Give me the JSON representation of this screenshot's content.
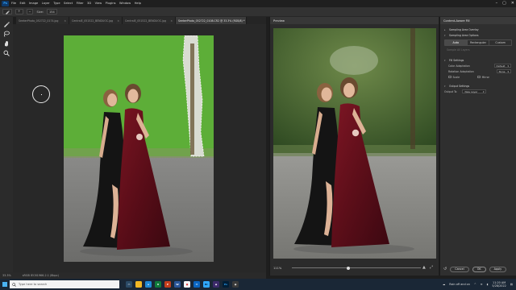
{
  "app": {
    "logo_text": "Ps",
    "menu": [
      "File",
      "Edit",
      "Image",
      "Layer",
      "Type",
      "Select",
      "Filter",
      "3D",
      "View",
      "Plugins",
      "Window",
      "Help"
    ],
    "window_controls": [
      "–",
      "▢",
      "✕"
    ]
  },
  "options_bar": {
    "size_label": "Size:",
    "size_value": "154"
  },
  "tabs": [
    {
      "label": "SeekerPhoto_052722_0174.jpg",
      "close": "×",
      "active": false
    },
    {
      "label": "CentralE_051522_BENDUOC.jpg",
      "close": "×",
      "active": false
    },
    {
      "label": "CentralE_051522_BENDUOC.jpg",
      "close": "×",
      "active": false
    },
    {
      "label": "SeekerPhoto_052722_0108.CR2 @ 33.3% (RGB/8) *",
      "close": "×",
      "active": true
    }
  ],
  "status": {
    "zoom": "33.3%",
    "doc_info": "sRGB IEC61966-2.1 (8bpc)"
  },
  "preview": {
    "tab_label": "Preview",
    "zoom_value": "111%"
  },
  "settings": {
    "title": "Content-Aware Fill",
    "sampling_overlay": "Sampling Area Overlay",
    "sampling_options": "Sampling Area Options",
    "seg_options": [
      "Auto",
      "Rectangular",
      "Custom"
    ],
    "sample_all_layers": "Sample All Layers",
    "fill_settings": "Fill Settings",
    "color_adaptation_label": "Color Adaptation",
    "color_adaptation_value": "Default",
    "rotation_adaptation_label": "Rotation Adaptation",
    "rotation_adaptation_value": "None",
    "scale_label": "Scale",
    "mirror_label": "Mirror",
    "output_settings": "Output Settings",
    "output_to_label": "Output To",
    "output_to_value": "New Layer",
    "cancel": "Cancel",
    "ok": "OK",
    "apply": "Apply"
  },
  "taskbar": {
    "search_placeholder": "Type here to search",
    "weather": "Rain off and on",
    "time": "11:20 AM",
    "date": "5/28/2022"
  }
}
